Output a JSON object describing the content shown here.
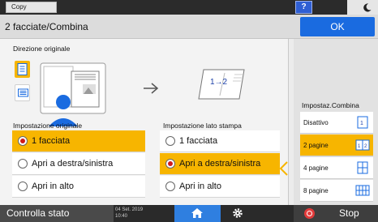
{
  "status_bar": {
    "app_tab": "Copy",
    "help_label": "?",
    "moon_icon": "moon-icon"
  },
  "title_bar": {
    "title": "2 facciate/Combina",
    "ok_label": "OK"
  },
  "direction": {
    "label": "Direzione originale",
    "buttons": [
      {
        "icon": "portrait-document-icon",
        "selected": true
      },
      {
        "icon": "landscape-document-icon",
        "selected": false
      }
    ]
  },
  "result_preview": {
    "text": "1→2"
  },
  "original_settings": {
    "label": "Impostazione originale",
    "options": [
      "1 facciata",
      "Apri a destra/sinistra",
      "Apri in alto"
    ],
    "selected": "1 facciata"
  },
  "print_side_settings": {
    "label": "Impostazione lato stampa",
    "options": [
      "1 facciata",
      "Apri a destra/sinistra",
      "Apri in alto"
    ],
    "selected": "Apri a destra/sinistra"
  },
  "combine_panel": {
    "title": "Impostaz.Combina",
    "items": [
      "Disattivo",
      "2 pagine",
      "4 pagine",
      "8 pagine"
    ],
    "selected": "2 pagine"
  },
  "bottom_bar": {
    "status_label": "Controlla stato",
    "date": "04 Set. 2019",
    "time": "10:40",
    "home_icon": "home-icon",
    "settings_icon": "gear-icon",
    "stop_label": "Stop"
  },
  "colors": {
    "accent_blue": "#1a6be0",
    "selection_yellow": "#f7b500",
    "stop_red": "#e23b3b"
  }
}
